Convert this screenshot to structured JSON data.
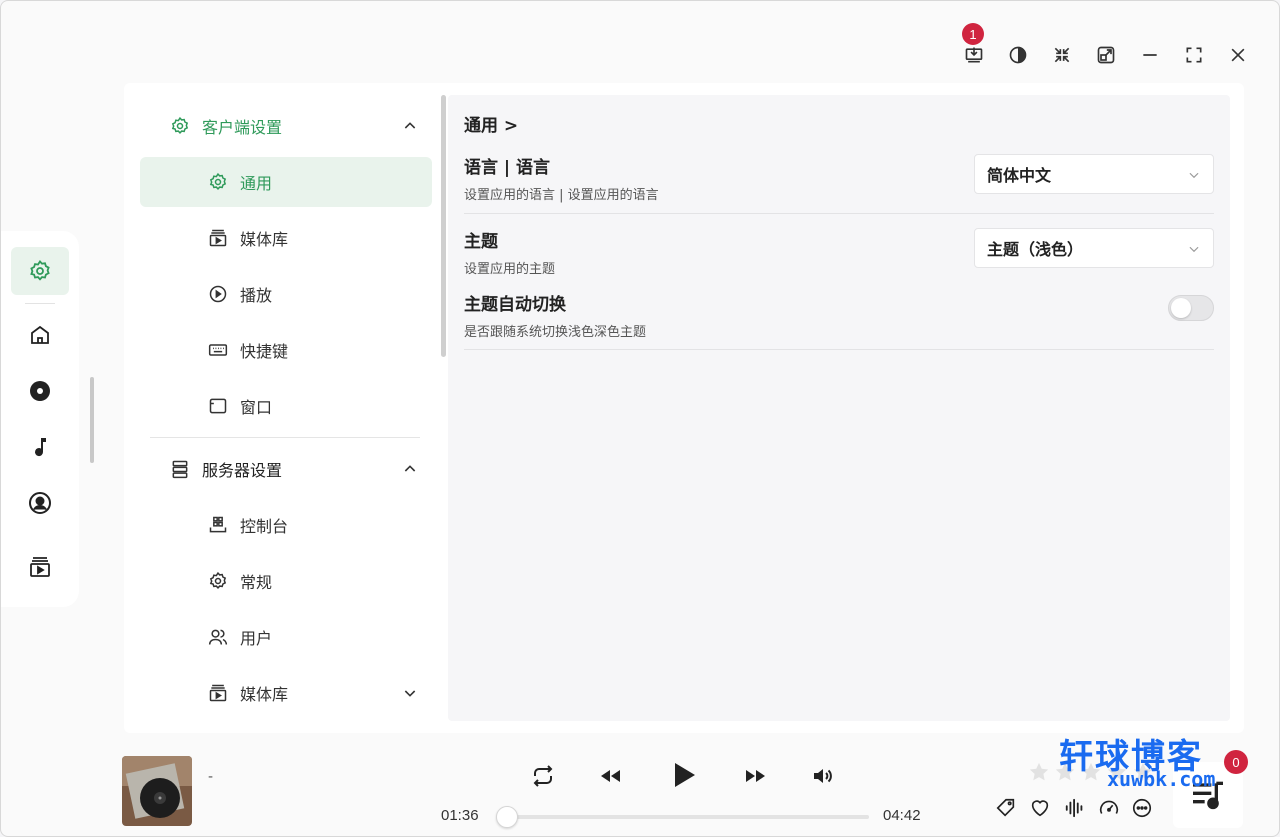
{
  "titlebar": {
    "download_badge": "1",
    "buttons": [
      "download-icon",
      "theme-contrast-icon",
      "collapse-icon",
      "popout-icon",
      "minimize-icon",
      "maximize-icon",
      "close-icon"
    ]
  },
  "rail": {
    "items": [
      "gear-icon",
      "home-icon",
      "disc-icon",
      "music-note-icon",
      "user-circle-icon",
      "media-library-icon"
    ],
    "active": "gear-icon"
  },
  "nav": {
    "client_group": "客户端设置",
    "client_items": [
      {
        "label": "通用",
        "icon": "gear-icon"
      },
      {
        "label": "媒体库",
        "icon": "media-library-icon"
      },
      {
        "label": "播放",
        "icon": "play-circle-icon"
      },
      {
        "label": "快捷键",
        "icon": "keyboard-icon"
      },
      {
        "label": "窗口",
        "icon": "window-icon"
      }
    ],
    "server_group": "服务器设置",
    "server_items": [
      {
        "label": "控制台",
        "icon": "dashboard-icon"
      },
      {
        "label": "常规",
        "icon": "gear-icon"
      },
      {
        "label": "用户",
        "icon": "users-icon"
      },
      {
        "label": "媒体库",
        "icon": "media-library-icon"
      }
    ]
  },
  "content": {
    "breadcrumb": "通用 >",
    "language": {
      "title": "语言 | 语言",
      "desc": "设置应用的语言 | 设置应用的语言",
      "value": "简体中文"
    },
    "theme": {
      "title": "主题",
      "desc": "设置应用的主题",
      "value": "主题（浅色）"
    },
    "auto_theme": {
      "title": "主题自动切换",
      "desc": "是否跟随系统切换浅色深色主题",
      "enabled": false
    }
  },
  "player": {
    "track_title": "-",
    "current_time": "01:36",
    "total_time": "04:42",
    "progress": 0,
    "rating": 0,
    "queue_count": "0"
  },
  "watermark": {
    "cn": "轩球博客",
    "en": "xuwbk.com"
  },
  "colors": {
    "accent": "#2f9a5a",
    "active_bg": "#e9f3ec",
    "badge": "#d0243f"
  }
}
